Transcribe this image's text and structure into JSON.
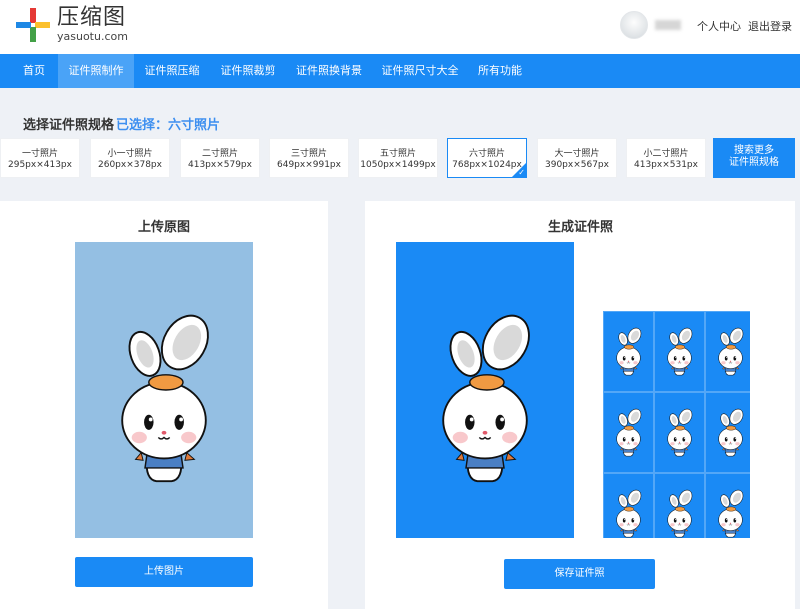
{
  "header": {
    "logo_cn": "压缩图",
    "logo_en": "yasuotu.com",
    "user_center": "个人中心",
    "logout": "退出登录"
  },
  "nav": {
    "items": [
      {
        "label": "首页"
      },
      {
        "label": "证件照制作"
      },
      {
        "label": "证件照压缩"
      },
      {
        "label": "证件照裁剪"
      },
      {
        "label": "证件照换背景"
      },
      {
        "label": "证件照尺寸大全"
      },
      {
        "label": "所有功能"
      }
    ],
    "active": "证件照制作"
  },
  "sizes": {
    "title": "选择证件照规格",
    "selected_text": "已选择：六寸照片",
    "items": [
      {
        "name": "一寸照片",
        "dim": "295px×413px"
      },
      {
        "name": "小一寸照片",
        "dim": "260px×378px"
      },
      {
        "name": "二寸照片",
        "dim": "413px×579px"
      },
      {
        "name": "三寸照片",
        "dim": "649px×991px"
      },
      {
        "name": "五寸照片",
        "dim": "1050px×1499px"
      },
      {
        "name": "六寸照片",
        "dim": "768px×1024px"
      },
      {
        "name": "大一寸照片",
        "dim": "390px×567px"
      },
      {
        "name": "小二寸照片",
        "dim": "413px×531px"
      }
    ],
    "search_more": [
      "搜索更多",
      "证件照规格"
    ]
  },
  "upload": {
    "title": "上传原图",
    "button": "上传图片"
  },
  "result": {
    "title": "生成证件照",
    "button": "保存证件照"
  },
  "colors": {
    "brand_blue": "#1a8af5",
    "upload_bg": "#94bfe3",
    "selected_text": "#3d8ff0"
  }
}
